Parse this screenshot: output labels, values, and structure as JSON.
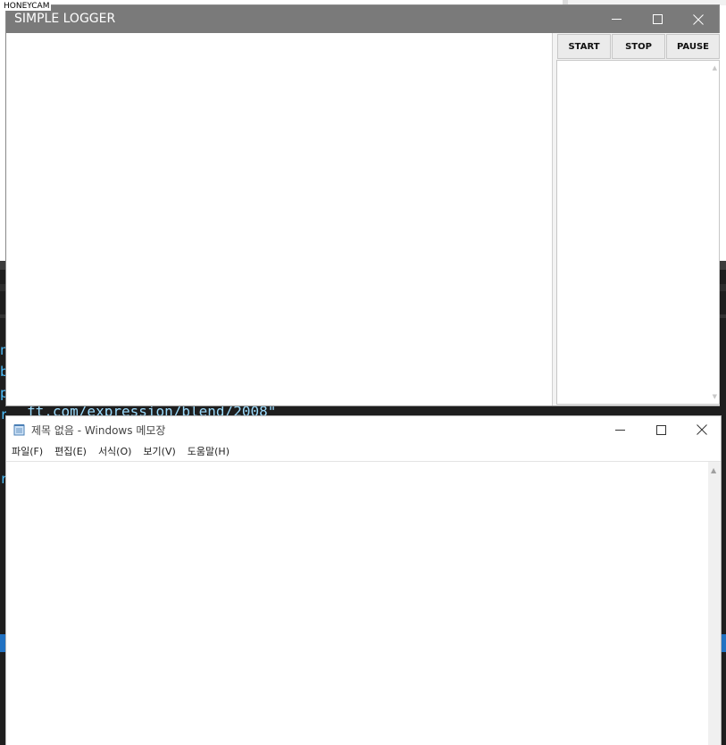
{
  "watermark": "HONEYCAM",
  "background_editor": {
    "code_fragment": "ft.com/expression/blend/2008\""
  },
  "logger": {
    "title": "SIMPLE LOGGER",
    "buttons": {
      "start": "START",
      "stop": "STOP",
      "pause": "PAUSE"
    },
    "log_lines": [],
    "list_items": []
  },
  "notepad": {
    "title": "제목 없음 - Windows 메모장",
    "menu": [
      {
        "label": "파일(F)"
      },
      {
        "label": "편집(E)"
      },
      {
        "label": "서식(O)"
      },
      {
        "label": "보기(V)"
      },
      {
        "label": "도움말(H)"
      }
    ],
    "content": ""
  },
  "icons": {
    "minimize": "minimize-icon",
    "maximize": "maximize-icon",
    "close": "close-icon",
    "notepad_app": "notepad-icon"
  },
  "colors": {
    "logger_titlebar": "#7a7a7a",
    "editor_background": "#1e1e1e",
    "accent_blue": "#2272c2"
  }
}
